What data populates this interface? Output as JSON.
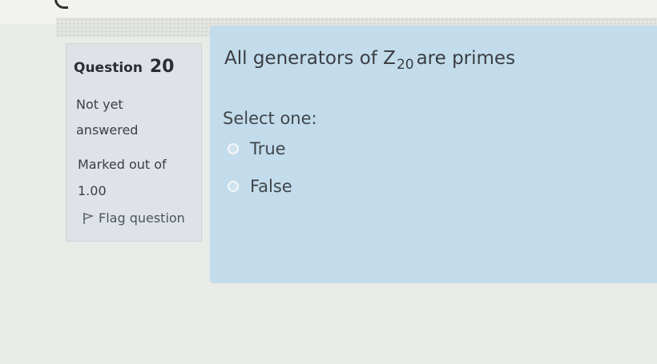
{
  "question": {
    "label": "Question",
    "number": "20",
    "state_line1": "Not yet",
    "state_line2": "answered",
    "grade_line1": "Marked out of",
    "grade_line2": "1.00",
    "flag_label": "Flag question",
    "flag_icon": "flag-icon"
  },
  "content": {
    "text_before": "All generators of Z",
    "subscript": "20",
    "text_after": "are primes",
    "prompt": "Select one:",
    "options": [
      {
        "label": "True",
        "selected": false
      },
      {
        "label": "False",
        "selected": false
      }
    ]
  },
  "colors": {
    "info_bg": "#dfe3e7",
    "content_bg": "#c3dceb"
  }
}
